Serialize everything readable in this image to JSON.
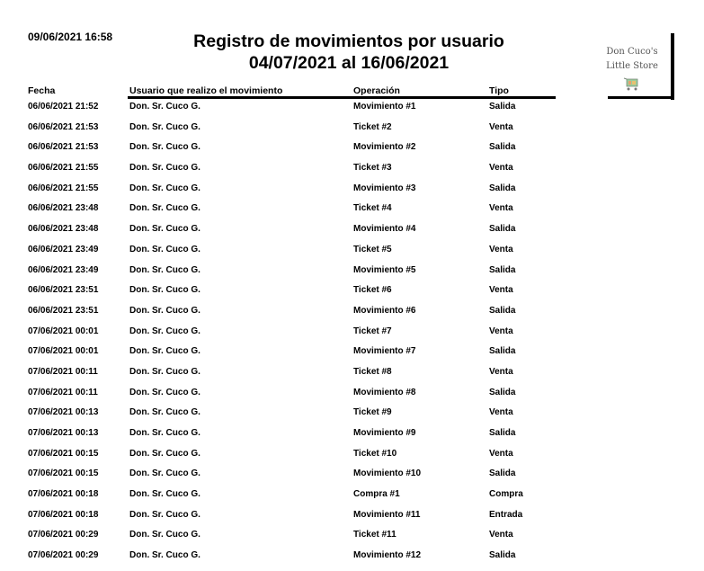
{
  "header": {
    "print_date": "09/06/2021 16:58",
    "title_line1": "Registro de movimientos por usuario",
    "title_line2": "04/07/2021 al 16/06/2021",
    "logo_line1": "Don Cuco's",
    "logo_line2": "Little Store"
  },
  "table": {
    "columns": [
      "Fecha",
      "Usuario que realizo el movimiento",
      "Operación",
      "Tipo"
    ],
    "rows": [
      [
        "06/06/2021 21:52",
        "Don. Sr. Cuco G.",
        "Movimiento #1",
        "Salida"
      ],
      [
        "06/06/2021 21:53",
        "Don. Sr. Cuco G.",
        "Ticket #2",
        "Venta"
      ],
      [
        "06/06/2021 21:53",
        "Don. Sr. Cuco G.",
        "Movimiento #2",
        "Salida"
      ],
      [
        "06/06/2021 21:55",
        "Don. Sr. Cuco G.",
        "Ticket #3",
        "Venta"
      ],
      [
        "06/06/2021 21:55",
        "Don. Sr. Cuco G.",
        "Movimiento #3",
        "Salida"
      ],
      [
        "06/06/2021 23:48",
        "Don. Sr. Cuco G.",
        "Ticket #4",
        "Venta"
      ],
      [
        "06/06/2021 23:48",
        "Don. Sr. Cuco G.",
        "Movimiento #4",
        "Salida"
      ],
      [
        "06/06/2021 23:49",
        "Don. Sr. Cuco G.",
        "Ticket #5",
        "Venta"
      ],
      [
        "06/06/2021 23:49",
        "Don. Sr. Cuco G.",
        "Movimiento #5",
        "Salida"
      ],
      [
        "06/06/2021 23:51",
        "Don. Sr. Cuco G.",
        "Ticket #6",
        "Venta"
      ],
      [
        "06/06/2021 23:51",
        "Don. Sr. Cuco G.",
        "Movimiento #6",
        "Salida"
      ],
      [
        "07/06/2021 00:01",
        "Don. Sr. Cuco G.",
        "Ticket #7",
        "Venta"
      ],
      [
        "07/06/2021 00:01",
        "Don. Sr. Cuco G.",
        "Movimiento #7",
        "Salida"
      ],
      [
        "07/06/2021 00:11",
        "Don. Sr. Cuco G.",
        "Ticket #8",
        "Venta"
      ],
      [
        "07/06/2021 00:11",
        "Don. Sr. Cuco G.",
        "Movimiento #8",
        "Salida"
      ],
      [
        "07/06/2021 00:13",
        "Don. Sr. Cuco G.",
        "Ticket #9",
        "Venta"
      ],
      [
        "07/06/2021 00:13",
        "Don. Sr. Cuco G.",
        "Movimiento #9",
        "Salida"
      ],
      [
        "07/06/2021 00:15",
        "Don. Sr. Cuco G.",
        "Ticket #10",
        "Venta"
      ],
      [
        "07/06/2021 00:15",
        "Don. Sr. Cuco G.",
        "Movimiento #10",
        "Salida"
      ],
      [
        "07/06/2021 00:18",
        "Don. Sr. Cuco G.",
        "Compra #1",
        "Compra"
      ],
      [
        "07/06/2021 00:18",
        "Don. Sr. Cuco G.",
        "Movimiento #11",
        "Entrada"
      ],
      [
        "07/06/2021 00:29",
        "Don. Sr. Cuco G.",
        "Ticket #11",
        "Venta"
      ],
      [
        "07/06/2021 00:29",
        "Don. Sr. Cuco G.",
        "Movimiento #12",
        "Salida"
      ]
    ]
  }
}
